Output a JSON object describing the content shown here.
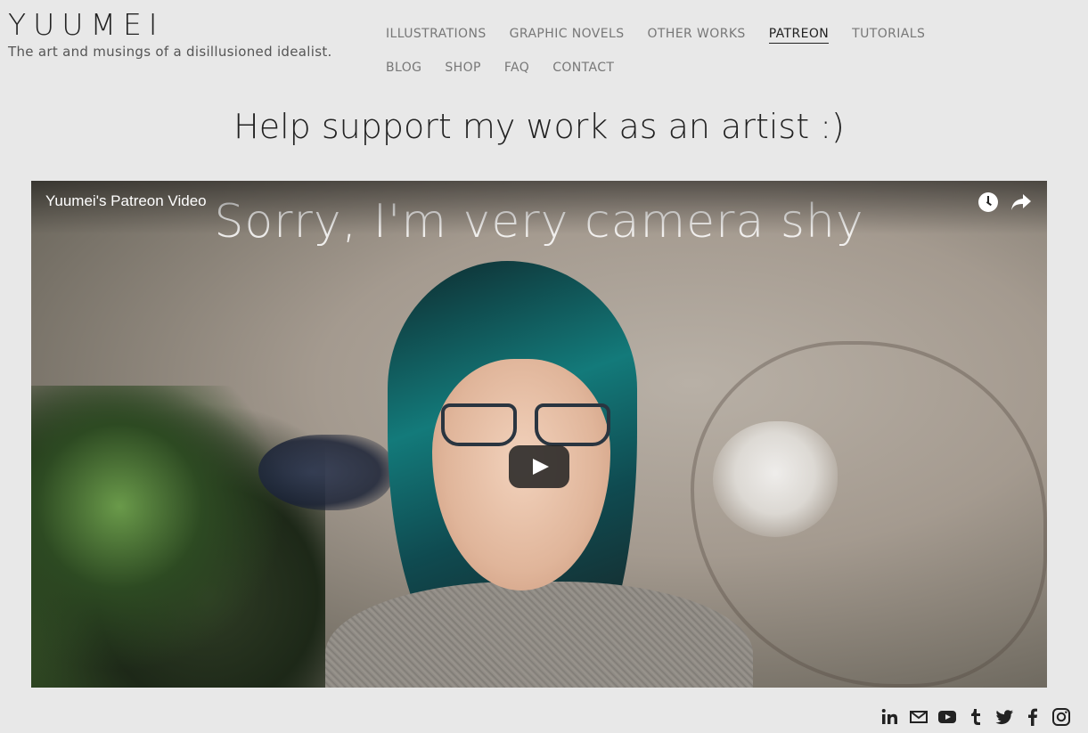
{
  "brand": {
    "title": "YUUMEI",
    "tagline": "The art and musings of a disillusioned idealist."
  },
  "nav": {
    "row1": [
      "ILLUSTRATIONS",
      "GRAPHIC NOVELS",
      "OTHER WORKS",
      "PATREON",
      "TUTORIALS"
    ],
    "row2": [
      "BLOG",
      "SHOP",
      "FAQ",
      "CONTACT"
    ],
    "active": "PATREON"
  },
  "headline": "Help support my work as an artist :)",
  "video": {
    "title": "Yuumei's Patreon Video",
    "caption": "Sorry, I'm very camera shy",
    "controls": [
      "watch-later-icon",
      "share-icon",
      "play-button"
    ]
  },
  "social": [
    "linkedin-icon",
    "email-icon",
    "youtube-icon",
    "tumblr-icon",
    "twitter-icon",
    "facebook-icon",
    "instagram-icon"
  ]
}
